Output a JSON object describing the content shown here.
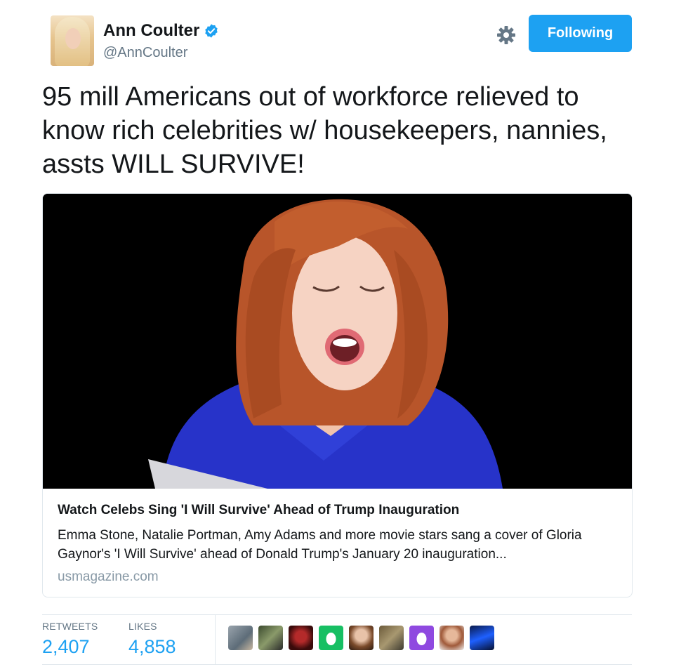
{
  "user": {
    "name": "Ann Coulter",
    "handle": "@AnnCoulter"
  },
  "header": {
    "follow_label": "Following"
  },
  "tweet": {
    "text": "95 mill Americans out of workforce relieved to know rich celebrities w/ housekeepers, nannies, assts WILL SURVIVE!"
  },
  "card": {
    "title": "Watch Celebs Sing 'I Will Survive' Ahead of Trump Inauguration",
    "description": "Emma Stone, Natalie Portman, Amy Adams and more movie stars sang a cover of Gloria Gaynor's 'I Will Survive' ahead of Donald Trump's January 20 inauguration...",
    "domain": "usmagazine.com"
  },
  "stats": {
    "retweets_label": "RETWEETS",
    "retweets": "2,407",
    "likes_label": "LIKES",
    "likes": "4,858"
  },
  "colors": {
    "accent": "#1da1f2",
    "text": "#14171a",
    "secondary": "#657786",
    "border": "#e1e8ed"
  },
  "icons": {
    "verified": "verified-badge-icon",
    "settings": "gear-icon"
  }
}
